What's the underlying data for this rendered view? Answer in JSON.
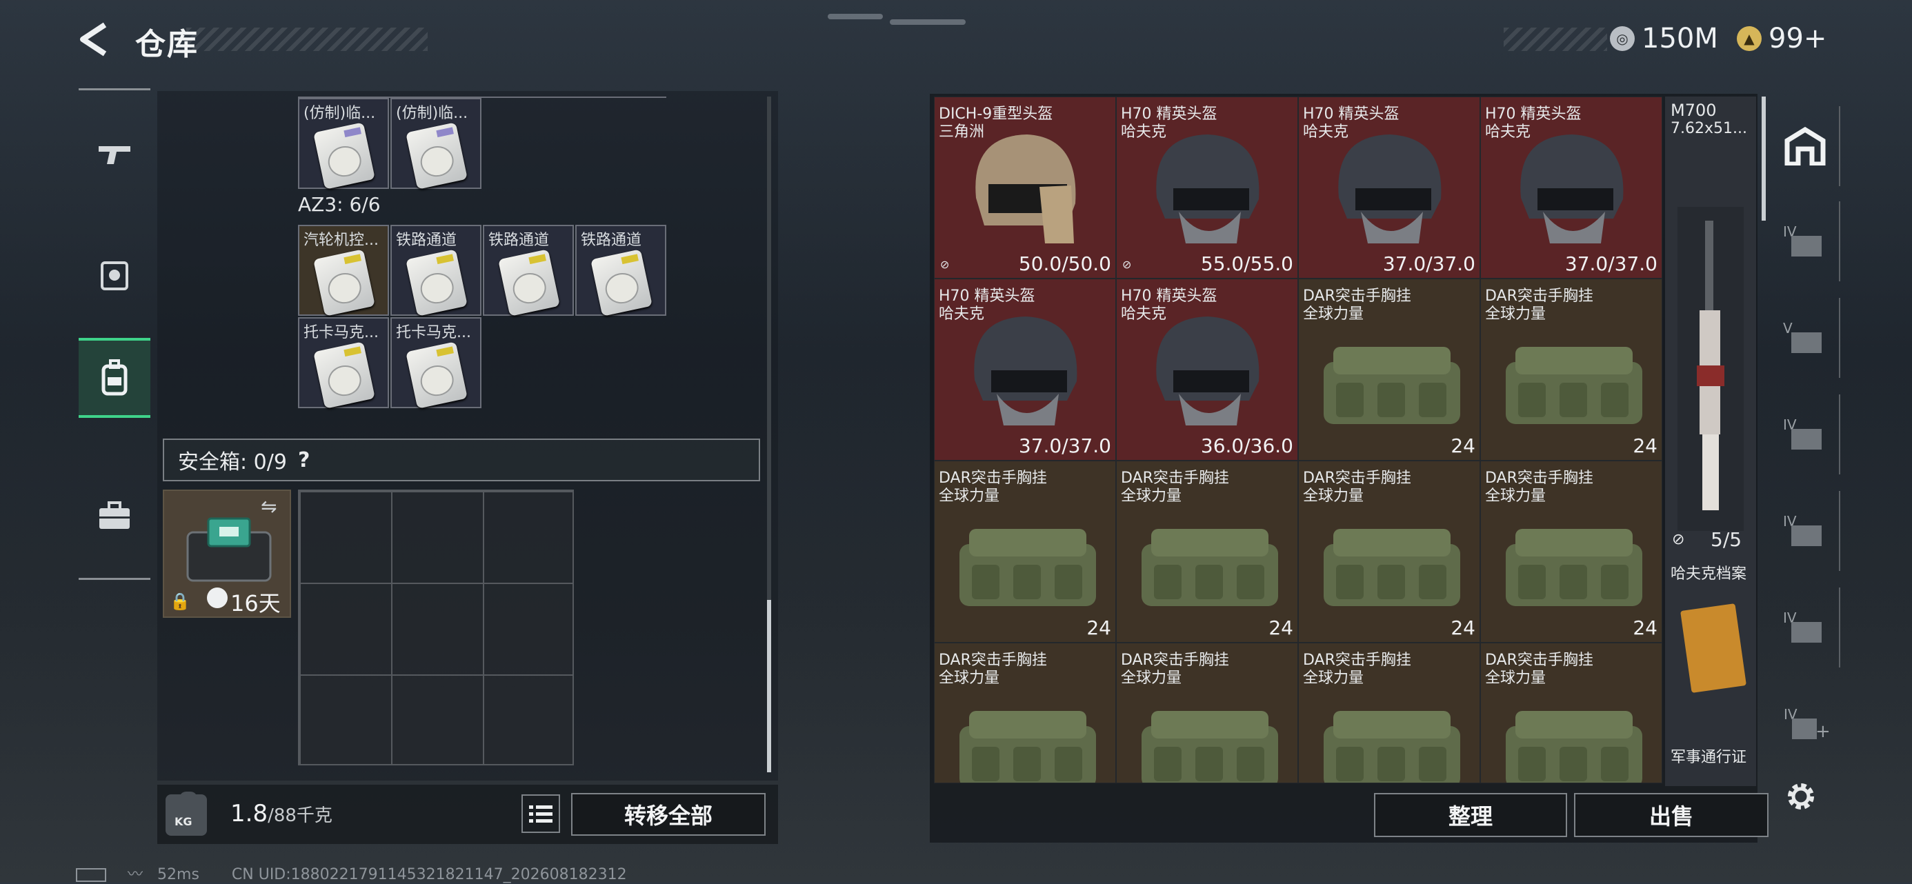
{
  "header": {
    "title": "仓库",
    "coins": "150M",
    "gems": "99+"
  },
  "left_rail": {
    "items": [
      "gun-icon",
      "badge-icon",
      "backpack-icon",
      "briefcase-icon"
    ]
  },
  "container_top": {
    "items": [
      "(仿制)临...",
      "(仿制)临..."
    ]
  },
  "az3": {
    "label": "AZ3: 6/6",
    "items": [
      "汽轮机控...",
      "铁路通道",
      "铁路通道",
      "铁路通道",
      "托卡马克...",
      "托卡马克..."
    ]
  },
  "safe_box": {
    "label": "安全箱: 0/9",
    "help": "?",
    "time": "16天"
  },
  "footer_left": {
    "weight": "1.8",
    "weight_max": "/88千克",
    "transfer_all": "转移全部",
    "kg": "KG"
  },
  "stash": {
    "row1": [
      {
        "l1": "DICH-9重型头盔",
        "l2": "三角洲",
        "v": "50.0/50.0"
      },
      {
        "l1": "H70 精英头盔",
        "l2": "哈夫克",
        "v": "55.0/55.0"
      },
      {
        "l1": "H70 精英头盔",
        "l2": "哈夫克",
        "v": "37.0/37.0"
      },
      {
        "l1": "H70 精英头盔",
        "l2": "哈夫克",
        "v": "37.0/37.0"
      }
    ],
    "row2": [
      {
        "l1": "H70 精英头盔",
        "l2": "哈夫克",
        "v": "37.0/37.0"
      },
      {
        "l1": "H70 精英头盔",
        "l2": "哈夫克",
        "v": "36.0/36.0"
      },
      {
        "l1": "DAR突击手胸挂",
        "l2": "全球力量",
        "v": "24"
      },
      {
        "l1": "DAR突击手胸挂",
        "l2": "全球力量",
        "v": "24"
      }
    ],
    "rig_name": "DAR突击手胸挂",
    "rig_brand": "全球力量",
    "rig_slots": "24",
    "weapon": {
      "name": "M700",
      "caliber": "7.62x51...",
      "count": "5/5"
    },
    "dossier": "哈夫克档案",
    "pass": "军事通行证"
  },
  "footer_right": {
    "organize": "整理",
    "sell": "出售"
  },
  "status_bar": {
    "ping": "52ms",
    "uid": "CN UID:1880221791145321821147_202608182312"
  }
}
